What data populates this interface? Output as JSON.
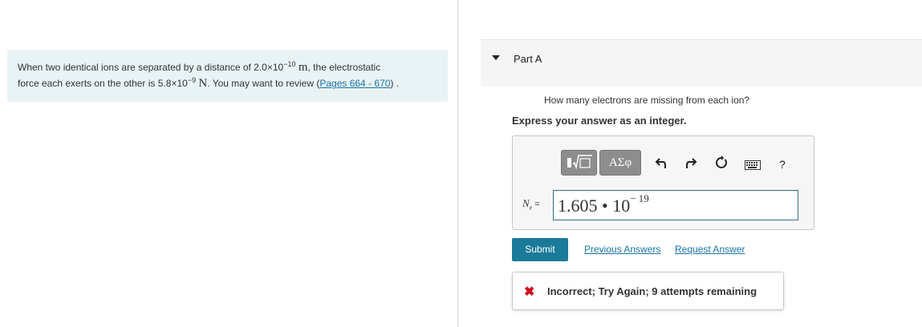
{
  "problem": {
    "text_1": "When two identical ions are separated by a distance of 2.0×10",
    "exp_1": "−10",
    "unit_1": "m",
    "text_2": ", the electrostatic",
    "text_3": "force each exerts on the other is 5.8×10",
    "exp_2": "−9",
    "unit_2": "N",
    "text_4": ". You may want to review (",
    "link": "Pages 664 - 670",
    "text_5": ") ."
  },
  "part": {
    "label": "Part A"
  },
  "question": "How many electrons are missing from each ion?",
  "instruction": "Express your answer as an integer.",
  "toolbar": {
    "greek_label": "ΑΣφ",
    "icons": [
      "template-icon",
      "undo-icon",
      "redo-icon",
      "reset-icon",
      "keyboard-icon",
      "help-icon"
    ],
    "help_label": "?"
  },
  "answer": {
    "label_symbol": "N",
    "label_sub": "e",
    "label_eq": " =",
    "mantissa": "1.605 • 10",
    "exponent": "− 19"
  },
  "actions": {
    "submit": "Submit",
    "previous": "Previous Answers",
    "request": "Request Answer"
  },
  "feedback": {
    "icon": "✖",
    "message": "Incorrect; Try Again; 9 attempts remaining",
    "status_color": "#d0021b"
  },
  "colors": {
    "accent": "#1b7a99",
    "panel_bg": "#e9f3f6"
  }
}
